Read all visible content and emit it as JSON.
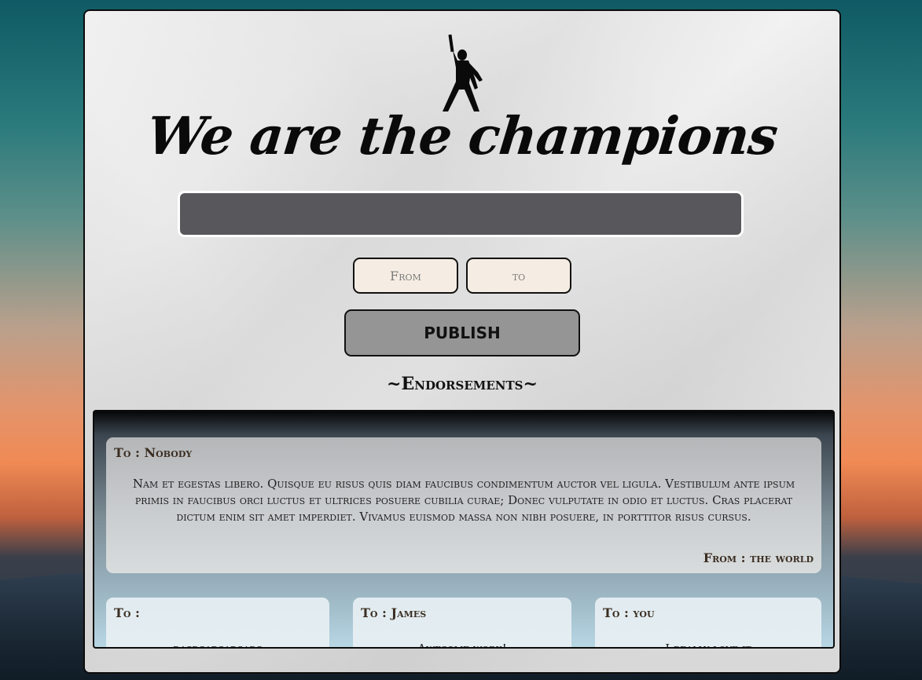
{
  "header": {
    "title": "We are the champions",
    "logo_icon": "freddie-silhouette-icon"
  },
  "form": {
    "message_value": "",
    "from_placeholder": "From",
    "to_placeholder": "to",
    "publish_label": "PUBLISH"
  },
  "endorsements": {
    "heading": "~Endorsements~",
    "items": [
      {
        "to": "To : Nobody",
        "text": "Nam et egestas libero. Quisque eu risus quis diam faucibus condimentum auctor vel ligula. Vestibulum ante ipsum primis in faucibus orci luctus et ultrices posuere cubilia curae; Donec vulputate in odio et luctus. Cras placerat dictum enim sit amet imperdiet. Vivamus euismod massa non nibh posuere, in porttitor risus cursus.",
        "from": "From : the world"
      },
      {
        "to": "To :",
        "text": "dasdsadsadsads"
      },
      {
        "to": "To : James",
        "text": "Awesome work!"
      },
      {
        "to": "To : you",
        "text": "I really love it"
      }
    ]
  },
  "colors": {
    "input_bg": "#58585c",
    "publish_bg": "#959595",
    "small_input_bg": "#f5ede3"
  }
}
